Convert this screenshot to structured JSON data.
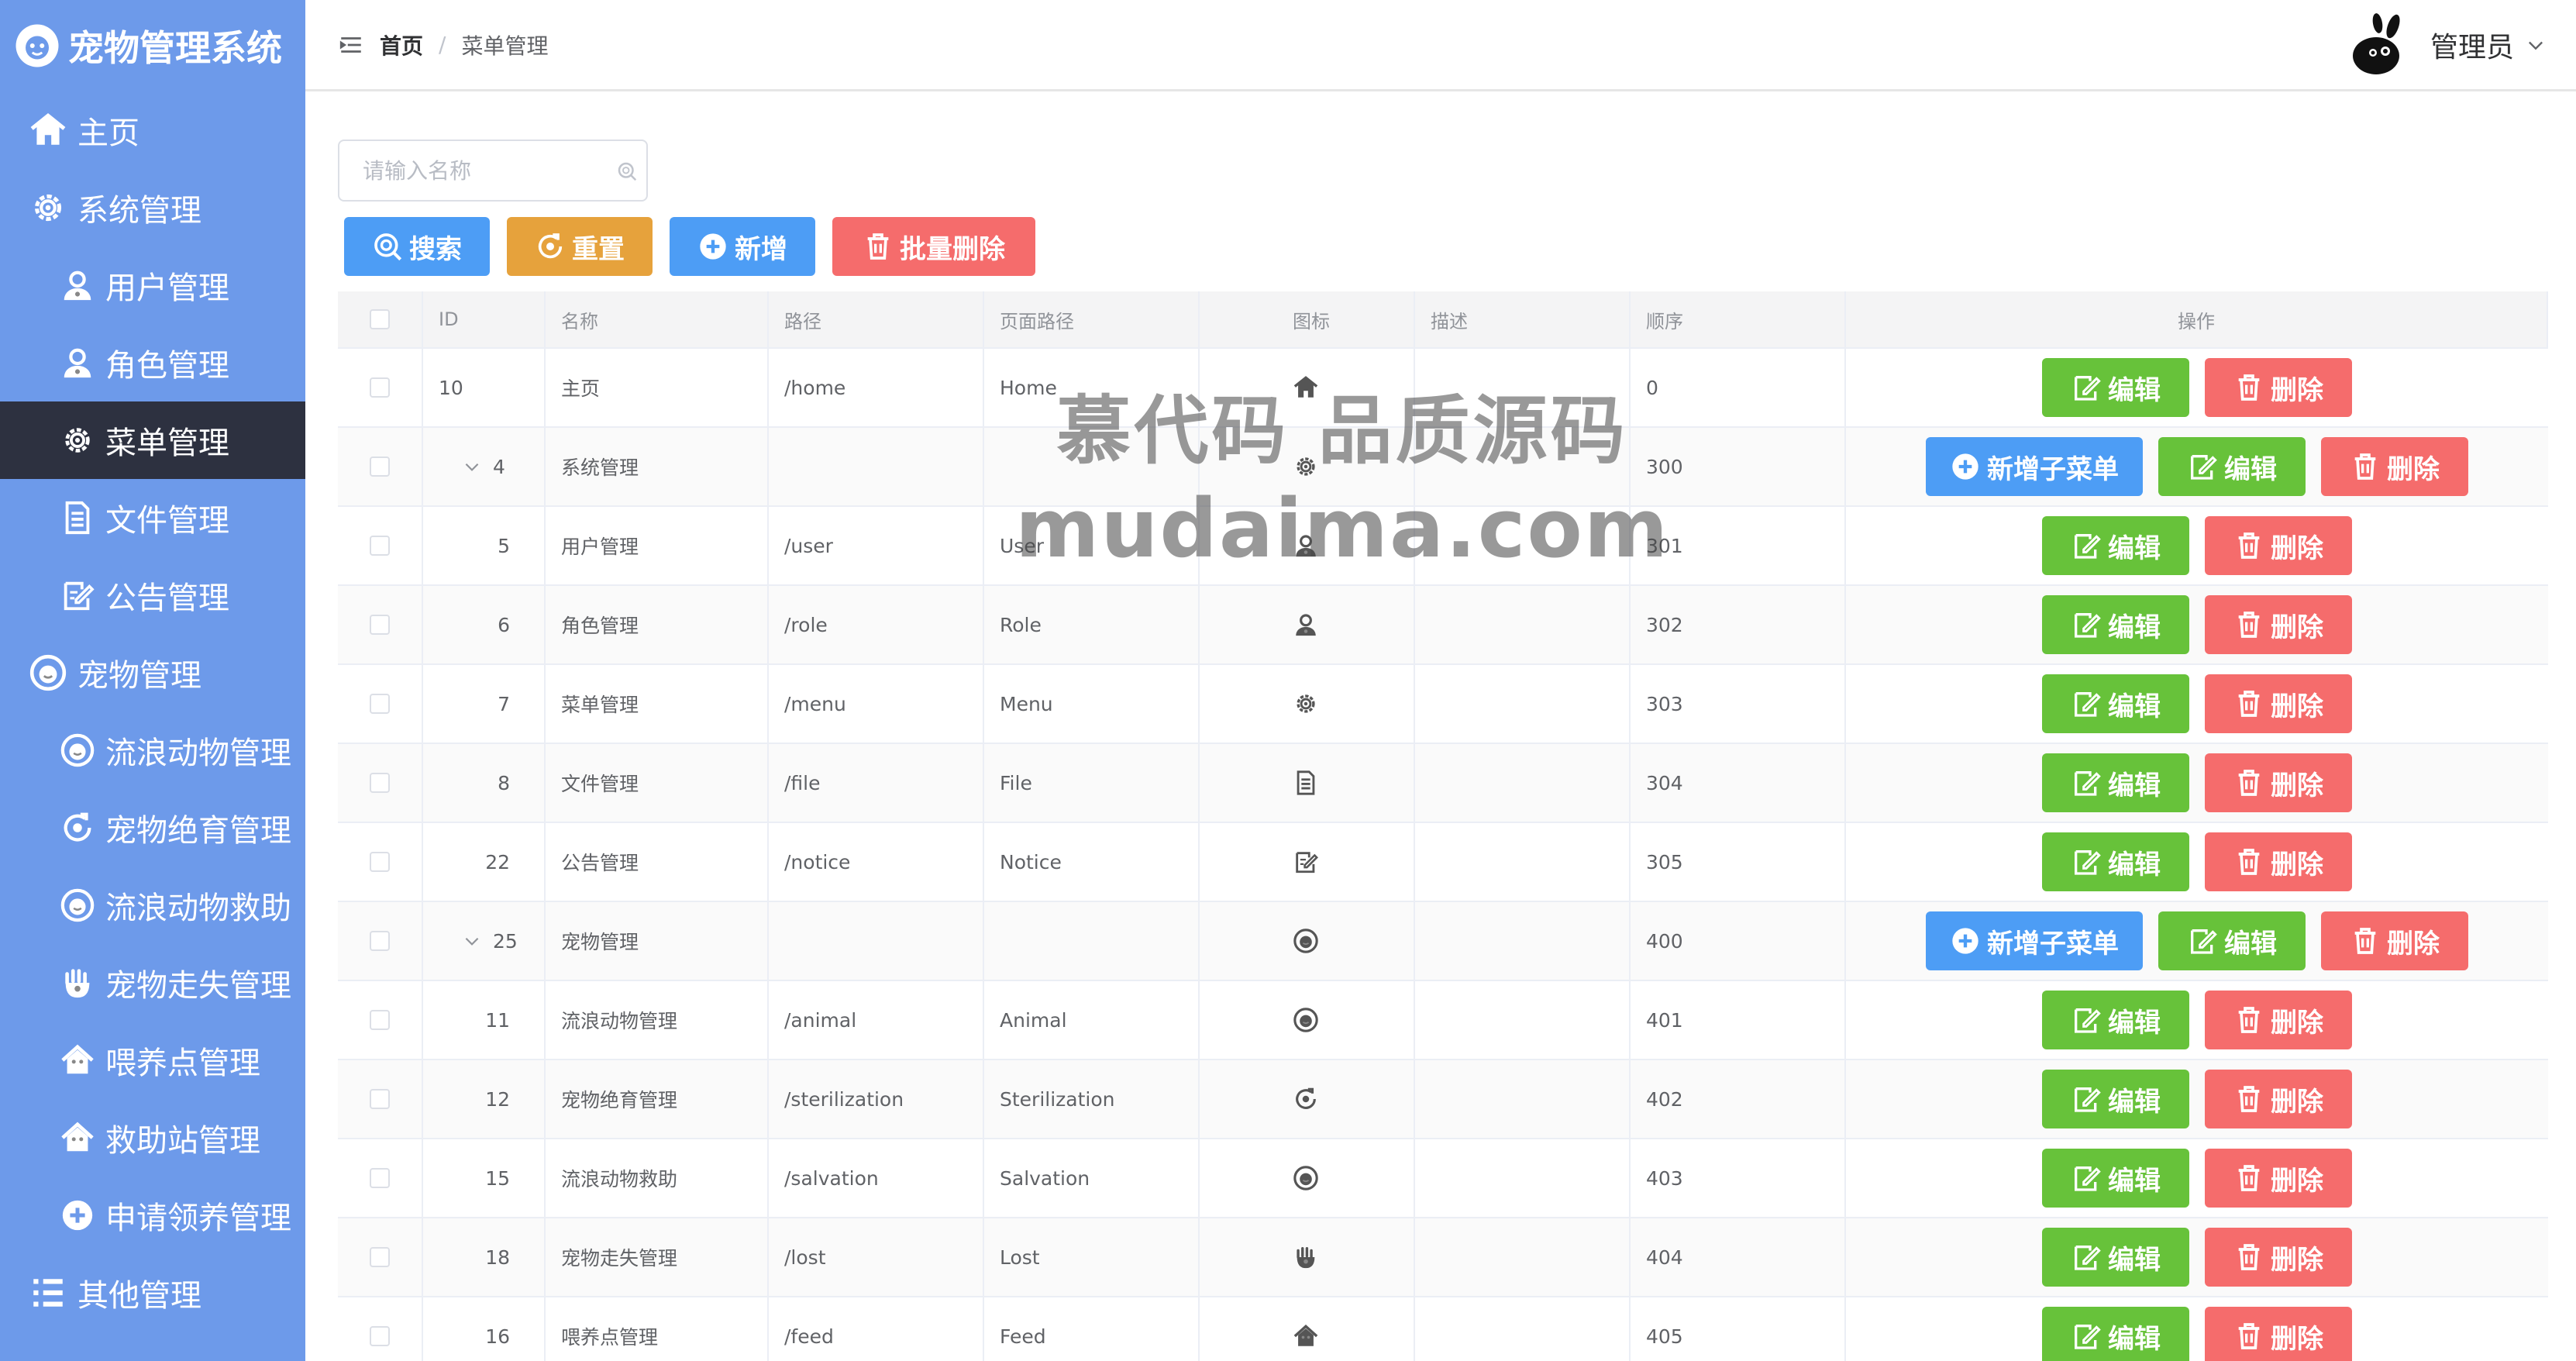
{
  "app": {
    "title": "宠物管理系统"
  },
  "sidebar": {
    "items": [
      {
        "label": "主页",
        "icon": "house-icon",
        "level": "top"
      },
      {
        "label": "系统管理",
        "icon": "gear-icon",
        "level": "top"
      },
      {
        "label": "用户管理",
        "icon": "user-icon",
        "level": "sub"
      },
      {
        "label": "角色管理",
        "icon": "user-icon",
        "level": "sub"
      },
      {
        "label": "菜单管理",
        "icon": "gear-icon",
        "level": "sub",
        "active": true
      },
      {
        "label": "文件管理",
        "icon": "document-icon",
        "level": "sub"
      },
      {
        "label": "公告管理",
        "icon": "edit-note-icon",
        "level": "sub"
      },
      {
        "label": "宠物管理",
        "icon": "pet-face-icon",
        "level": "top"
      },
      {
        "label": "流浪动物管理",
        "icon": "pet-face-icon",
        "level": "sub"
      },
      {
        "label": "宠物绝育管理",
        "icon": "refresh-target-icon",
        "level": "sub"
      },
      {
        "label": "流浪动物救助",
        "icon": "pet-face-icon",
        "level": "sub"
      },
      {
        "label": "宠物走失管理",
        "icon": "paw-hand-icon",
        "level": "sub"
      },
      {
        "label": "喂养点管理",
        "icon": "shelter-icon",
        "level": "sub"
      },
      {
        "label": "救助站管理",
        "icon": "shelter-icon",
        "level": "sub"
      },
      {
        "label": "申请领养管理",
        "icon": "plus-circle-icon",
        "level": "sub"
      },
      {
        "label": "其他管理",
        "icon": "list-icon",
        "level": "top"
      }
    ]
  },
  "header": {
    "breadcrumb_home": "首页",
    "breadcrumb_separator": "/",
    "breadcrumb_current": "菜单管理",
    "user_name": "管理员"
  },
  "toolbar": {
    "search_placeholder": "请输入名称",
    "search_label": "搜索",
    "reset_label": "重置",
    "add_label": "新增",
    "batch_delete_label": "批量删除"
  },
  "table": {
    "columns": [
      "ID",
      "名称",
      "路径",
      "页面路径",
      "图标",
      "描述",
      "顺序",
      "操作"
    ],
    "edit_label": "编辑",
    "delete_label": "删除",
    "add_child_label": "新增子菜单",
    "rows": [
      {
        "id": "10",
        "name": "主页",
        "path": "/home",
        "page": "Home",
        "icon": "house-icon",
        "desc": "",
        "order": "0",
        "parent": false,
        "child": false
      },
      {
        "id": "4",
        "name": "系统管理",
        "path": "",
        "page": "",
        "icon": "gear-icon",
        "desc": "",
        "order": "300",
        "parent": true,
        "child": false
      },
      {
        "id": "5",
        "name": "用户管理",
        "path": "/user",
        "page": "User",
        "icon": "user-icon",
        "desc": "",
        "order": "301",
        "parent": false,
        "child": true
      },
      {
        "id": "6",
        "name": "角色管理",
        "path": "/role",
        "page": "Role",
        "icon": "user-icon",
        "desc": "",
        "order": "302",
        "parent": false,
        "child": true
      },
      {
        "id": "7",
        "name": "菜单管理",
        "path": "/menu",
        "page": "Menu",
        "icon": "gear-icon",
        "desc": "",
        "order": "303",
        "parent": false,
        "child": true
      },
      {
        "id": "8",
        "name": "文件管理",
        "path": "/file",
        "page": "File",
        "icon": "document-icon",
        "desc": "",
        "order": "304",
        "parent": false,
        "child": true
      },
      {
        "id": "22",
        "name": "公告管理",
        "path": "/notice",
        "page": "Notice",
        "icon": "edit-note-icon",
        "desc": "",
        "order": "305",
        "parent": false,
        "child": true
      },
      {
        "id": "25",
        "name": "宠物管理",
        "path": "",
        "page": "",
        "icon": "pet-face-icon",
        "desc": "",
        "order": "400",
        "parent": true,
        "child": false
      },
      {
        "id": "11",
        "name": "流浪动物管理",
        "path": "/animal",
        "page": "Animal",
        "icon": "pet-face-icon",
        "desc": "",
        "order": "401",
        "parent": false,
        "child": true
      },
      {
        "id": "12",
        "name": "宠物绝育管理",
        "path": "/sterilization",
        "page": "Sterilization",
        "icon": "refresh-target-icon",
        "desc": "",
        "order": "402",
        "parent": false,
        "child": true
      },
      {
        "id": "15",
        "name": "流浪动物救助",
        "path": "/salvation",
        "page": "Salvation",
        "icon": "pet-face-icon",
        "desc": "",
        "order": "403",
        "parent": false,
        "child": true
      },
      {
        "id": "18",
        "name": "宠物走失管理",
        "path": "/lost",
        "page": "Lost",
        "icon": "paw-hand-icon",
        "desc": "",
        "order": "404",
        "parent": false,
        "child": true
      },
      {
        "id": "16",
        "name": "喂养点管理",
        "path": "/feed",
        "page": "Feed",
        "icon": "shelter-icon",
        "desc": "",
        "order": "405",
        "parent": false,
        "child": true
      }
    ]
  },
  "watermark": {
    "line1": "慕代码 品质源码",
    "line2": "mudaima.com"
  },
  "colors": {
    "sidebar": "#6d9aea",
    "sidebar_active": "#2d3140",
    "primary": "#4d9df5",
    "warning": "#e6a23c",
    "danger": "#f56c6c",
    "success": "#67c23a"
  }
}
